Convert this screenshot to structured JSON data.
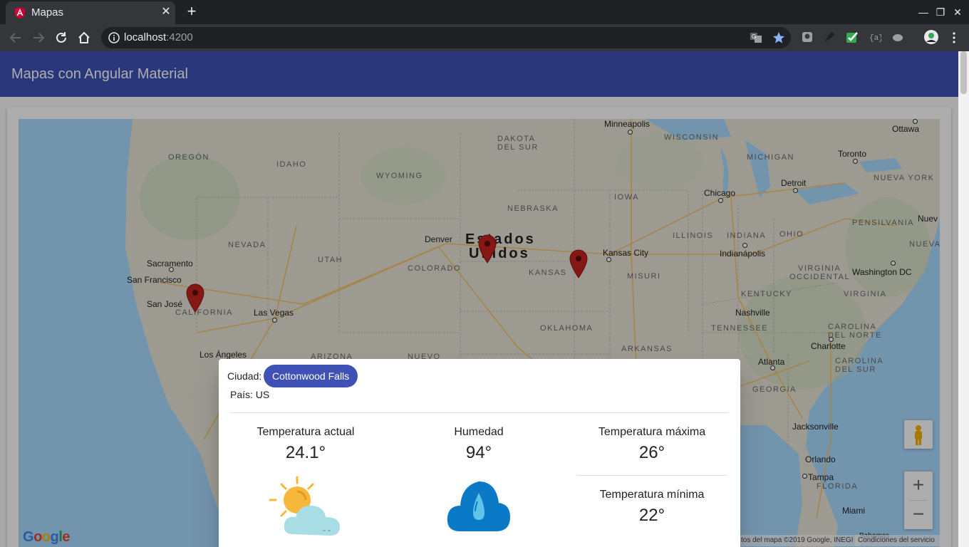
{
  "browser": {
    "tab_title": "Mapas",
    "new_tab": "+",
    "close_tab": "✕",
    "url_host": "localhost",
    "url_port": ":4200",
    "window": {
      "minimize": "—",
      "restore": "❐",
      "close": "✕"
    }
  },
  "app": {
    "title": "Mapas con Angular Material"
  },
  "map": {
    "states": [
      {
        "name": "OREGÓN"
      },
      {
        "name": "IDAHO"
      },
      {
        "name": "WYOMING"
      },
      {
        "name": "DAKOTA"
      },
      {
        "name": "DEL SUR"
      },
      {
        "name": "NEBRASKA"
      },
      {
        "name": "NEVADA"
      },
      {
        "name": "UTAH"
      },
      {
        "name": "COLORADO"
      },
      {
        "name": "KANSAS"
      },
      {
        "name": "CALIFORNIA"
      },
      {
        "name": "ARIZONA"
      },
      {
        "name": "NUEVO"
      },
      {
        "name": "OKLAHOMA"
      },
      {
        "name": "IOWA"
      },
      {
        "name": "MISURI"
      },
      {
        "name": "ARKANSAS"
      },
      {
        "name": "WISCONSIN"
      },
      {
        "name": "MICHIGAN"
      },
      {
        "name": "ILLINOIS"
      },
      {
        "name": "INDIANA"
      },
      {
        "name": "OHIO"
      },
      {
        "name": "KENTUCKY"
      },
      {
        "name": "TENNESSEE"
      },
      {
        "name": "GEORGIA"
      },
      {
        "name": "VIRGINIA"
      },
      {
        "name": "OCCIDENTAL"
      },
      {
        "name": "CAROLINA"
      },
      {
        "name": "DEL NORTE"
      },
      {
        "name": "DEL SUR"
      },
      {
        "name": "PENSILVANIA"
      },
      {
        "name": "NUEVA YORK"
      },
      {
        "name": "FLORIDA"
      },
      {
        "name": "NUEVA"
      },
      {
        "name": "CAROLINA"
      },
      {
        "name": "VIRGINIA"
      }
    ],
    "cities": [
      {
        "name": "Minneapolis"
      },
      {
        "name": "Ottawa"
      },
      {
        "name": "Toronto"
      },
      {
        "name": "Detroit"
      },
      {
        "name": "Chicago"
      },
      {
        "name": "Denver"
      },
      {
        "name": "Kansas City"
      },
      {
        "name": "Indianápolis"
      },
      {
        "name": "Washington DC"
      },
      {
        "name": "Sacramento"
      },
      {
        "name": "San Francisco"
      },
      {
        "name": "San José"
      },
      {
        "name": "Las Vegas"
      },
      {
        "name": "Los Ángeles"
      },
      {
        "name": "Nashville"
      },
      {
        "name": "Charlotte"
      },
      {
        "name": "Atlanta"
      },
      {
        "name": "Jacksonville"
      },
      {
        "name": "Orlando"
      },
      {
        "name": "Tampa"
      },
      {
        "name": "Miami"
      },
      {
        "name": "Nuev"
      },
      {
        "name": "Bahamas"
      }
    ],
    "country_line1": "Estados",
    "country_line2": "Unidos",
    "google": [
      "G",
      "o",
      "o",
      "g",
      "l",
      "e"
    ],
    "attribution": "tos del mapa ©2019 Google, INEGI",
    "terms": "Condiciones del servicio",
    "zoom_in": "+",
    "zoom_out": "−"
  },
  "weather": {
    "ciudad_label": "Ciudad:",
    "ciudad": "Cottonwood Falls",
    "pais": "País: US",
    "temp_actual_label": "Temperatura actual",
    "temp_actual": "24.1°",
    "humedad_label": "Humedad",
    "humedad": "94°",
    "temp_max_label": "Temperatura máxima",
    "temp_max": "26°",
    "temp_min_label": "Temperatura mínima",
    "temp_min": "22°"
  },
  "colors": {
    "primary": "#3f51b5",
    "marker": "#c5221f",
    "water": "#aadaff",
    "land": "#e8e4d8"
  }
}
